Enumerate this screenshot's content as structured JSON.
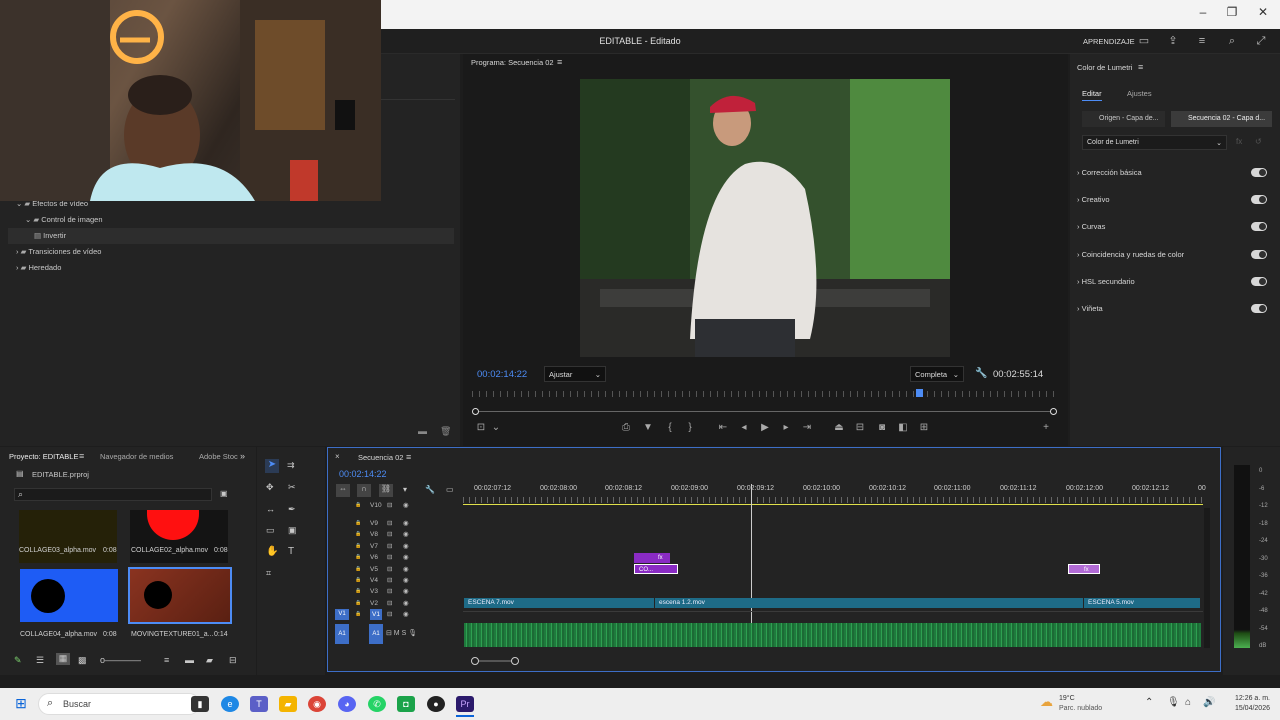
{
  "app": {
    "title": "EDITABLE - Editado",
    "learn_label": "APRENDIZAJE"
  },
  "effects_tree": {
    "items": [
      {
        "label": "Efectos de vídeo",
        "level": 0
      },
      {
        "label": "Control de imagen",
        "level": 1
      },
      {
        "label": "Invertir",
        "level": 2
      },
      {
        "label": "Transiciones de vídeo",
        "level": 0
      },
      {
        "label": "Heredado",
        "level": 0
      }
    ]
  },
  "program_monitor": {
    "title": "Programa: Secuencia 02",
    "current_tc": "00:02:14:22",
    "fit_label": "Ajustar",
    "quality_label": "Completa",
    "duration_tc": "00:02:55:14"
  },
  "lumetri": {
    "title": "Color de Lumetri",
    "tabs": [
      "Editar",
      "Ajustes"
    ],
    "source_label": "Origen - Capa de...",
    "sequence_label": "Secuencia 02 - Capa d...",
    "effect_select": "Color de Lumetri",
    "sections": [
      "Corrección básica",
      "Creativo",
      "Curvas",
      "Coincidencia y ruedas de color",
      "HSL secundario",
      "Viñeta"
    ]
  },
  "project": {
    "tabs": [
      "Proyecto: EDITABLE",
      "Navegador de medios",
      "Adobe Stoc"
    ],
    "file": "EDITABLE.prproj",
    "items": [
      {
        "name": "COLLAGE03_alpha.mov",
        "dur": "0:08"
      },
      {
        "name": "COLLAGE02_alpha.mov",
        "dur": "0:08"
      },
      {
        "name": "COLLAGE04_alpha.mov",
        "dur": "0:08"
      },
      {
        "name": "MOVINGTEXTURE01_a...",
        "dur": "0:14"
      }
    ]
  },
  "timeline": {
    "sequence_name": "Secuencia 02",
    "current_tc": "00:02:14:22",
    "ruler": [
      "00:02:07:12",
      "00:02:08:00",
      "00:02:08:12",
      "00:02:09:00",
      "00:02:09:12",
      "00:02:10:00",
      "00:02:10:12",
      "00:02:11:00",
      "00:02:11:12",
      "00:02:12:00",
      "00:02:12:12",
      "00"
    ],
    "video_tracks": [
      "V10",
      "V9",
      "V8",
      "V7",
      "V6",
      "V5",
      "V4",
      "V3",
      "V2",
      "V1"
    ],
    "audio_tracks": [
      "A1"
    ],
    "clips": {
      "v1_a": "ESCENA 7.mov",
      "v1_b": "escena 1.2.mov",
      "v1_c": "ESCENA 5.mov",
      "v5_small": "CO...",
      "fx": "fx"
    },
    "meter_labels": [
      "0",
      "-6",
      "-12",
      "-18",
      "-24",
      "-30",
      "-36",
      "-42",
      "-48",
      "-54",
      "dB"
    ]
  },
  "taskbar": {
    "search_placeholder": "Buscar",
    "weather_temp": "19°C",
    "weather_desc": "Parc. nublado",
    "time": "12:26 a. m.",
    "date": "15/04/2026"
  }
}
